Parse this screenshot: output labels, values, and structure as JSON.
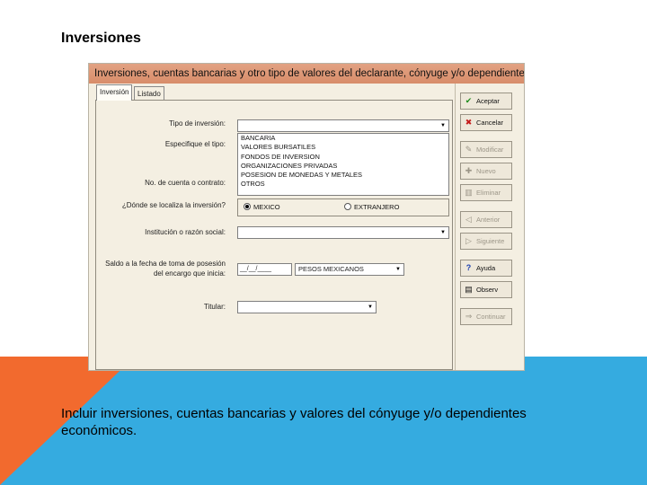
{
  "slide": {
    "title": "Inversiones",
    "caption": "Incluir inversiones, cuentas bancarias y valores del cónyuge y/o dependientes económicos."
  },
  "window": {
    "title": "Inversiones, cuentas bancarias y otro tipo de valores del declarante, cónyuge y/o dependiente...",
    "tabs": [
      {
        "label": "Inversión",
        "active": true
      },
      {
        "label": "Listado",
        "active": false
      }
    ]
  },
  "form": {
    "tipo_label": "Tipo de inversión:",
    "tipo_value": "",
    "especifique_label": "Especifique el tipo:",
    "especifique_options": [
      "BANCARIA",
      "VALORES BURSATILES",
      "FONDOS DE INVERSION",
      "ORGANIZACIONES PRIVADAS",
      "POSESION DE MONEDAS Y METALES",
      "OTROS"
    ],
    "cuenta_label": "No. de cuenta o contrato:",
    "ubicacion_label": "¿Dónde se localiza la inversión?",
    "ubicacion_options": [
      {
        "label": "MEXICO",
        "selected": true
      },
      {
        "label": "EXTRANJERO",
        "selected": false
      }
    ],
    "institucion_label": "Institución o razón social:",
    "institucion_value": "",
    "saldo_label": "Saldo a la fecha de toma de posesión del encargo que inicia:",
    "saldo_date": "__/__/____",
    "moneda_value": "PESOS MEXICANOS",
    "titular_label": "Titular:",
    "titular_value": ""
  },
  "buttons": [
    {
      "label": "Aceptar",
      "icon": "check-icon",
      "glyph": "✔",
      "color": "#1a8a1a",
      "enabled": true
    },
    {
      "label": "Cancelar",
      "icon": "x-icon",
      "glyph": "✖",
      "color": "#c41a1a",
      "enabled": true
    },
    {
      "label": "Modificar",
      "icon": "edit-icon",
      "glyph": "✎",
      "color": "#9c9688",
      "enabled": false
    },
    {
      "label": "Nuevo",
      "icon": "new-icon",
      "glyph": "✚",
      "color": "#9c9688",
      "enabled": false
    },
    {
      "label": "Eliminar",
      "icon": "trash-icon",
      "glyph": "▥",
      "color": "#9c9688",
      "enabled": false
    },
    {
      "label": "Anterior",
      "icon": "arrow-left-icon",
      "glyph": "◁",
      "color": "#9c9688",
      "enabled": false
    },
    {
      "label": "Siguiente",
      "icon": "arrow-right-icon",
      "glyph": "▷",
      "color": "#9c9688",
      "enabled": false
    },
    {
      "label": "Ayuda",
      "icon": "help-icon",
      "glyph": "?",
      "color": "#1a3fb0",
      "enabled": true
    },
    {
      "label": "Observ",
      "icon": "notes-icon",
      "glyph": "▤",
      "color": "#333333",
      "enabled": true
    },
    {
      "label": "Continuar",
      "icon": "continue-icon",
      "glyph": "⇒",
      "color": "#9c9688",
      "enabled": false
    }
  ],
  "colors": {
    "title_bar": "#d88d6a",
    "window_bg": "#f4efe2",
    "band_blue": "#35abe0",
    "band_orange": "#f26a2e"
  }
}
